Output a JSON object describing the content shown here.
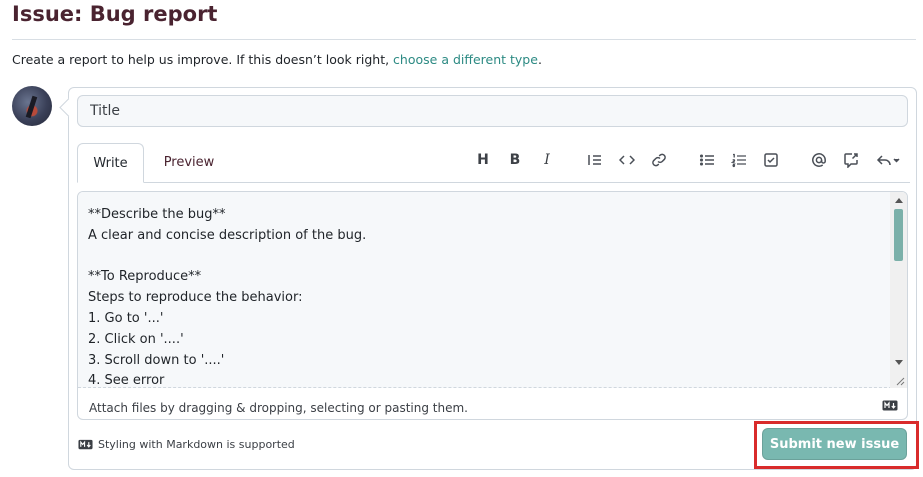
{
  "page": {
    "title": "Issue: Bug report",
    "intro_text": "Create a report to help us improve. If this doesn’t look right, ",
    "intro_link": "choose a different type",
    "intro_end": "."
  },
  "form": {
    "title_placeholder": "Title",
    "tabs": {
      "write": "Write",
      "preview": "Preview"
    },
    "toolbar": {
      "heading": "H",
      "bold": "B",
      "italic": "I",
      "icons": [
        "heading-icon",
        "bold-icon",
        "italic-icon",
        "quote-icon",
        "code-icon",
        "link-icon",
        "bulleted-list-icon",
        "numbered-list-icon",
        "task-list-icon",
        "mention-icon",
        "reference-icon",
        "reply-icon"
      ]
    },
    "body_text": "**Describe the bug**\nA clear and concise description of the bug.\n\n**To Reproduce**\nSteps to reproduce the behavior:\n1. Go to '...'\n2. Click on '....'\n3. Scroll down to '....'\n4. See error",
    "attach_text": "Attach files by dragging & dropping, selecting or pasting them.",
    "markdown_note": "Styling with Markdown is supported",
    "submit_label": "Submit new issue"
  },
  "colors": {
    "title": "#4a2330",
    "link": "#2c8a83",
    "submit_bg": "#79b8b0",
    "highlight": "#d92b2b"
  }
}
